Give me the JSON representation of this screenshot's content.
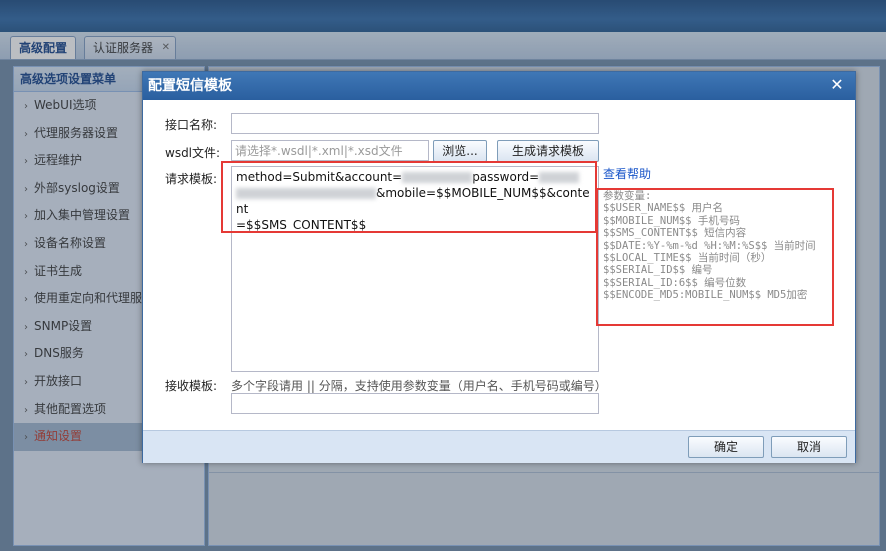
{
  "tabs": [
    {
      "label": "高级配置",
      "active": true
    },
    {
      "label": "认证服务器",
      "active": false
    }
  ],
  "menu": {
    "title": "高级选项设置菜单",
    "items": [
      {
        "label": "WebUI选项"
      },
      {
        "label": "代理服务器设置"
      },
      {
        "label": "远程维护"
      },
      {
        "label": "外部syslog设置"
      },
      {
        "label": "加入集中管理设置"
      },
      {
        "label": "设备名称设置"
      },
      {
        "label": "证书生成"
      },
      {
        "label": "使用重定向和代理服"
      },
      {
        "label": "SNMP设置"
      },
      {
        "label": "DNS服务"
      },
      {
        "label": "开放接口"
      },
      {
        "label": "其他配置选项"
      },
      {
        "label": "通知设置",
        "selected": true
      }
    ]
  },
  "dialog": {
    "title": "配置短信模板",
    "interface_name_label": "接口名称:",
    "interface_name_value": "",
    "wsdl_label": "wsdl文件:",
    "wsdl_placeholder": "请选择*.wsdl|*.xml|*.xsd文件",
    "browse_button": "浏览...",
    "generate_button": "生成请求模板",
    "request_label": "请求模板:",
    "request_part1": "method=Submit&account=",
    "request_part2": "password=",
    "request_part3": "&mobile=$$MOBILE_NUM$$&content",
    "request_part4": "=$$SMS_CONTENT$$",
    "help_link": "查看帮助",
    "params_text": "参数变量:\n$$USER_NAME$$ 用户名\n$$MOBILE_NUM$$ 手机号码\n$$SMS_CONTENT$$ 短信内容\n$$DATE:%Y-%m-%d %H:%M:%S$$ 当前时间\n$$LOCAL_TIME$$ 当前时间（秒）\n$$SERIAL_ID$$ 编号\n$$SERIAL_ID:6$$ 编号位数\n$$ENCODE_MD5:MOBILE_NUM$$ MD5加密",
    "receive_label": "接收模板:",
    "receive_hint": "多个字段请用 || 分隔，支持使用参数变量（用户名、手机号码或编号）",
    "receive_value": "",
    "ok_button": "确定",
    "cancel_button": "取消"
  },
  "colors": {
    "highlight_box": "#e53935",
    "link": "#1a56c9",
    "title_bar": "#2a5f9f"
  }
}
